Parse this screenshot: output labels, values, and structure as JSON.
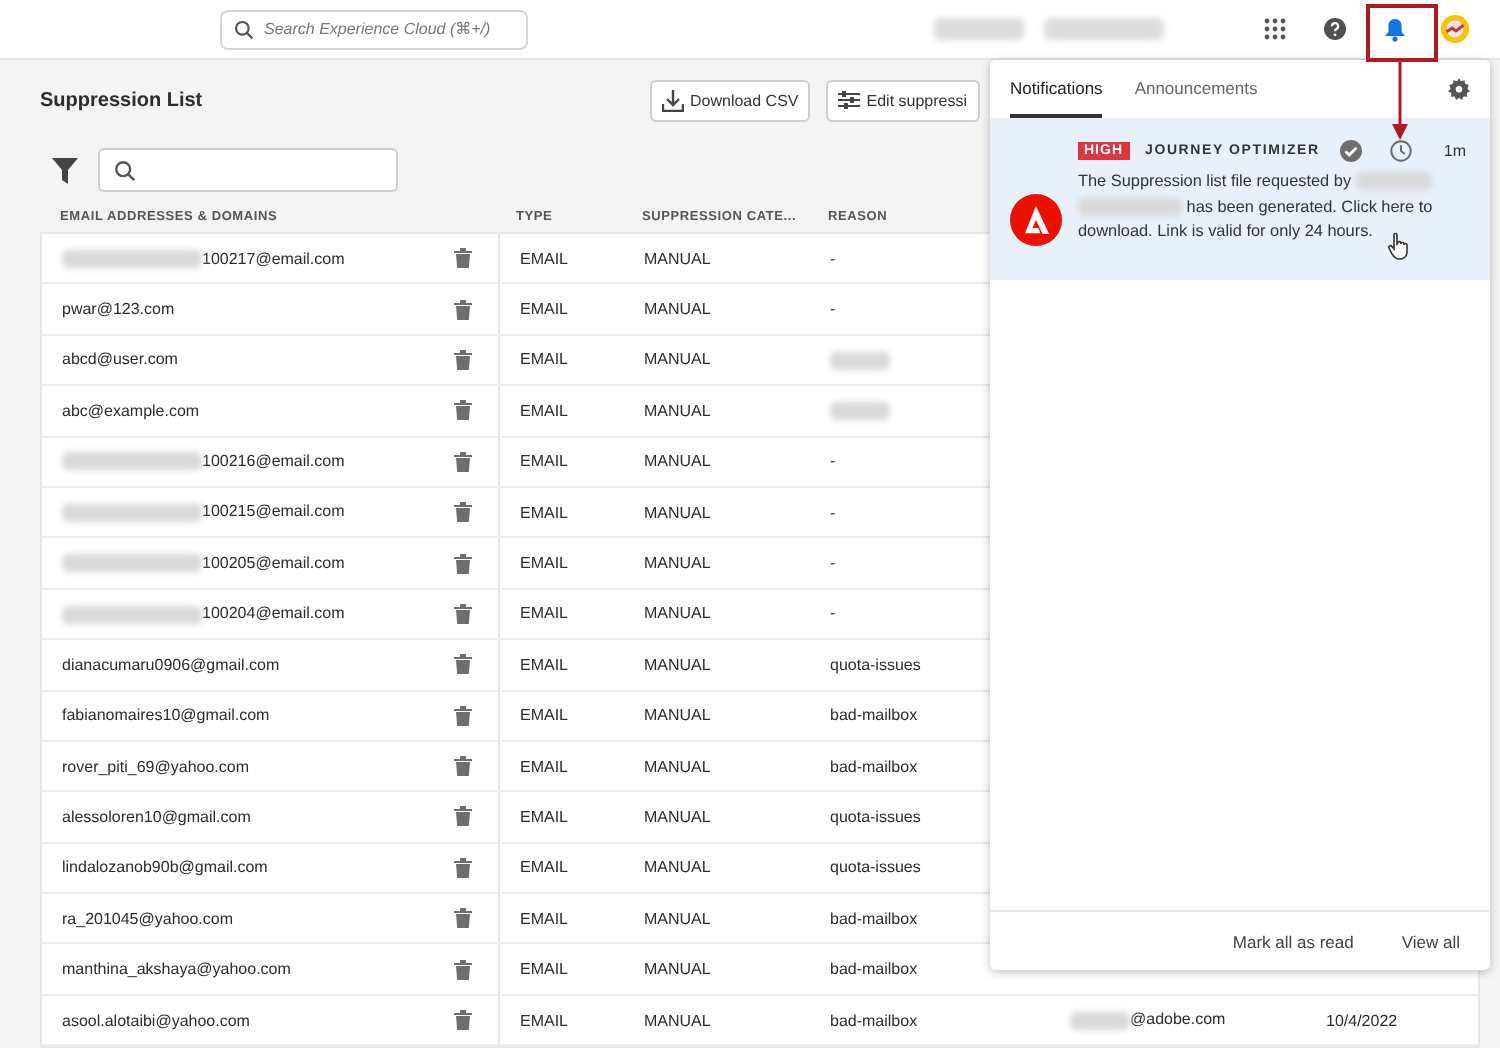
{
  "top_bar": {
    "search": {
      "placeholder": "Search Experience Cloud (⌘+/)"
    },
    "notifications_open": true
  },
  "page": {
    "title": "Suppression List",
    "buttons": [
      {
        "label": "Download CSV",
        "kind": "download"
      },
      {
        "label": "Edit suppressi",
        "kind": "edit"
      }
    ]
  },
  "table": {
    "columns": [
      "EMAIL ADDRESSES & DOMAINS",
      "TYPE",
      "SUPPRESSION CATE...",
      "REASON"
    ],
    "rows": [
      {
        "email": "100217@email.com",
        "email_redacted": true,
        "type": "EMAIL",
        "category": "MANUAL",
        "reason": "-"
      },
      {
        "email": "pwar@123.com",
        "email_redacted": false,
        "type": "EMAIL",
        "category": "MANUAL",
        "reason": "-"
      },
      {
        "email": "abcd@user.com",
        "email_redacted": false,
        "type": "EMAIL",
        "category": "MANUAL",
        "reason_redacted": true
      },
      {
        "email": "abc@example.com",
        "email_redacted": false,
        "type": "EMAIL",
        "category": "MANUAL",
        "reason_redacted": true
      },
      {
        "email": "100216@email.com",
        "email_redacted": true,
        "type": "EMAIL",
        "category": "MANUAL",
        "reason": "-"
      },
      {
        "email": "100215@email.com",
        "email_redacted": true,
        "type": "EMAIL",
        "category": "MANUAL",
        "reason": "-"
      },
      {
        "email": "100205@email.com",
        "email_redacted": true,
        "type": "EMAIL",
        "category": "MANUAL",
        "reason": "-"
      },
      {
        "email": "100204@email.com",
        "email_redacted": true,
        "type": "EMAIL",
        "category": "MANUAL",
        "reason": "-"
      },
      {
        "email": "dianacumaru0906@gmail.com",
        "email_redacted": false,
        "type": "EMAIL",
        "category": "MANUAL",
        "reason": "quota-issues"
      },
      {
        "email": "fabianomaires10@gmail.com",
        "email_redacted": false,
        "type": "EMAIL",
        "category": "MANUAL",
        "reason": "bad-mailbox"
      },
      {
        "email": "rover_piti_69@yahoo.com",
        "email_redacted": false,
        "type": "EMAIL",
        "category": "MANUAL",
        "reason": "bad-mailbox"
      },
      {
        "email": "alessoloren10@gmail.com",
        "email_redacted": false,
        "type": "EMAIL",
        "category": "MANUAL",
        "reason": "quota-issues"
      },
      {
        "email": "lindalozanob90b@gmail.com",
        "email_redacted": false,
        "type": "EMAIL",
        "category": "MANUAL",
        "reason": "quota-issues"
      },
      {
        "email": "ra_201045@yahoo.com",
        "email_redacted": false,
        "type": "EMAIL",
        "category": "MANUAL",
        "reason": "bad-mailbox"
      },
      {
        "email": "manthina_akshaya@yahoo.com",
        "email_redacted": false,
        "type": "EMAIL",
        "category": "MANUAL",
        "reason": "bad-mailbox"
      },
      {
        "email": "asool.alotaibi@yahoo.com",
        "email_redacted": false,
        "type": "EMAIL",
        "category": "MANUAL",
        "reason": "bad-mailbox",
        "column_5": "@adobe.com",
        "column_5_redacted": true,
        "column_6": "10/4/2022"
      }
    ]
  },
  "notification_panel": {
    "tabs": [
      {
        "label": "Notifications",
        "selected": true
      },
      {
        "label": "Announcements",
        "selected": false
      }
    ],
    "notifications": [
      {
        "priority": "HIGH",
        "source": "JOURNEY OPTIMIZER",
        "time": "1m",
        "read": false,
        "text_before": "The Suppression list file requested by",
        "text_after": "has been generated. Click here to download. Link is valid for only 24 hours."
      }
    ],
    "actions": [
      "Mark all as read",
      "View all"
    ]
  }
}
